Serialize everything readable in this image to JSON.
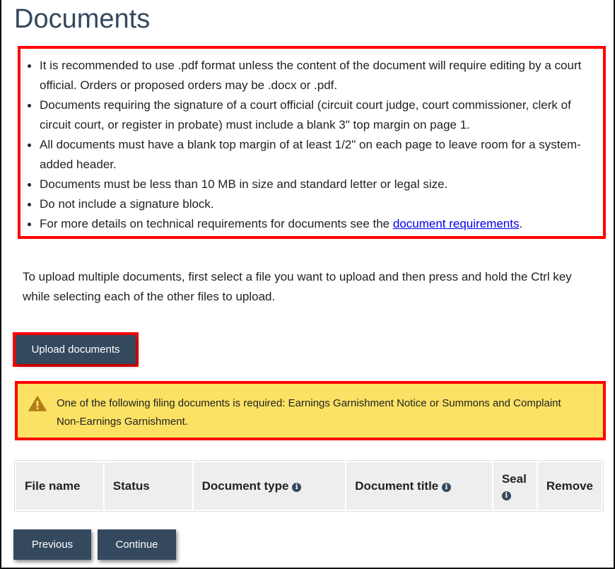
{
  "page": {
    "title": "Documents"
  },
  "requirements": {
    "items": [
      "It is recommended to use .pdf format unless the content of the document will require editing by a court official. Orders or proposed orders may be .docx or .pdf.",
      "Documents requiring the signature of a court official (circuit court judge, court commissioner, clerk of circuit court, or register in probate) must include a blank 3\" top margin on page 1.",
      "All documents must have a blank top margin of at least 1/2\" on each page to leave room for a system-added header.",
      "Documents must be less than 10 MB in size and standard letter or legal size.",
      "Do not include a signature block."
    ],
    "last_item_prefix": "For more details on technical requirements for documents see the ",
    "last_item_link": "document requirements",
    "last_item_suffix": "."
  },
  "instructions": "To upload multiple documents, first select a file you want to upload and then press and hold the Ctrl key while selecting each of the other files to upload.",
  "upload_button": "Upload documents",
  "warning": {
    "icon": "warning-triangle-icon",
    "text": "One of the following filing documents is required: Earnings Garnishment Notice or Summons and Complaint Non-Earnings Garnishment."
  },
  "table": {
    "columns": [
      {
        "label": "File name",
        "info": false
      },
      {
        "label": "Status",
        "info": false
      },
      {
        "label": "Document type",
        "info": true
      },
      {
        "label": "Document title",
        "info": true
      },
      {
        "label": "Seal",
        "info": true
      },
      {
        "label": "Remove",
        "info": false
      }
    ],
    "info_glyph": "i",
    "rows": []
  },
  "navigation": {
    "previous": "Previous",
    "continue": "Continue"
  },
  "colors": {
    "primary": "#34495e",
    "highlight_border": "#ff0000",
    "warning_bg": "#fbe264",
    "warning_icon": "#b07d1a",
    "link": "#0000ee"
  }
}
